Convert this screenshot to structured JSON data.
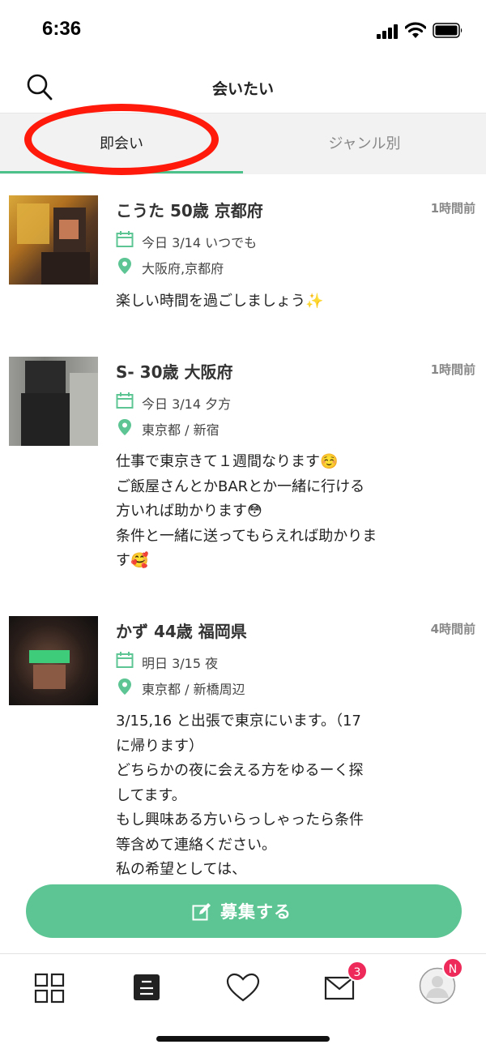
{
  "status_bar": {
    "time": "6:36"
  },
  "header": {
    "title": "会いたい"
  },
  "tabs": [
    {
      "label": "即会い",
      "active": true
    },
    {
      "label": "ジャンル別",
      "active": false
    }
  ],
  "posts": [
    {
      "name": "こうた 50歳 京都府",
      "time_ago": "1時間前",
      "date": "今日 3/14 いつでも",
      "location": "大阪府,京都府",
      "body": "楽しい時間を過ごしましょう✨"
    },
    {
      "name": "S- 30歳 大阪府",
      "time_ago": "1時間前",
      "date": "今日 3/14 夕方",
      "location": "東京都 / 新宿",
      "body": "仕事で東京きて１週間なります☺️\nご飯屋さんとかBARとか一緒に行ける\n方いれば助かります😳\n条件と一緒に送ってもらえれば助かりま\nす🥰"
    },
    {
      "name": "かず 44歳 福岡県",
      "time_ago": "4時間前",
      "date": "明日 3/15 夜",
      "location": "東京都 / 新橋周辺",
      "body": "3/15,16 と出張で東京にいます。（17\nに帰ります）\nどちらかの夜に会える方をゆるーく探\nしてます。\nもし興味ある方いらっしゃったら条件\n等含めて連絡ください。\n私の希望としては、"
    }
  ],
  "recruit_button": {
    "label": "募集する"
  },
  "bottom_nav": {
    "messages_badge": "3",
    "profile_badge": "N"
  },
  "colors": {
    "accent": "#5cc593",
    "highlight": "#ff1a0c",
    "badge": "#ee2a5a"
  }
}
